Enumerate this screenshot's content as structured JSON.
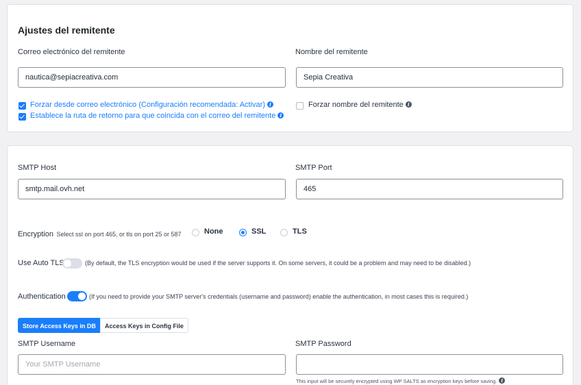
{
  "sender": {
    "title": "Ajustes del remitente",
    "email_label": "Correo electrónico del remitente",
    "email_value": "nautica@sepiacreativa.com",
    "name_label": "Nombre del remitente",
    "name_value": "Sepia Creativa",
    "force_from_label": "Forzar desde correo electrónico (Configuración recomendada: Activar)",
    "force_from_checked": true,
    "return_path_label": "Establece la ruta de retorno para que coincida con el correo del remitente",
    "return_path_checked": true,
    "force_name_label": "Forzar nombre del remitente",
    "force_name_checked": false
  },
  "smtp": {
    "host_label": "SMTP Host",
    "host_value": "smtp.mail.ovh.net",
    "port_label": "SMTP Port",
    "port_value": "465",
    "encryption_label": "Encryption",
    "encryption_hint": "Select ssl on port 465, or tls on port 25 or 587",
    "encryption_options": [
      "None",
      "SSL",
      "TLS"
    ],
    "encryption_selected": "SSL",
    "auto_tls_label": "Use Auto TLS",
    "auto_tls_enabled": false,
    "auto_tls_hint": "(By default, the TLS encryption would be used if the server supports it. On some servers, it could be a problem and may need to be disabled.)",
    "auth_label": "Authentication",
    "auth_enabled": true,
    "auth_hint": "(If you need to provide your SMTP server's credentials (username and password) enable the authentication, in most cases this is required.)",
    "tabs": [
      "Store Access Keys in DB",
      "Access Keys in Config File"
    ],
    "active_tab": "Store Access Keys in DB",
    "username_label": "SMTP Username",
    "username_placeholder": "Your SMTP Username",
    "password_label": "SMTP Password",
    "password_note": "This input will be securely encrypted using WP SALTS as encryption keys before saving."
  },
  "icons": {
    "info": "info-icon",
    "check": "check-icon"
  },
  "colors": {
    "accent": "#1a7efb",
    "border": "#dcdfe6",
    "background": "#f1f1f3"
  }
}
